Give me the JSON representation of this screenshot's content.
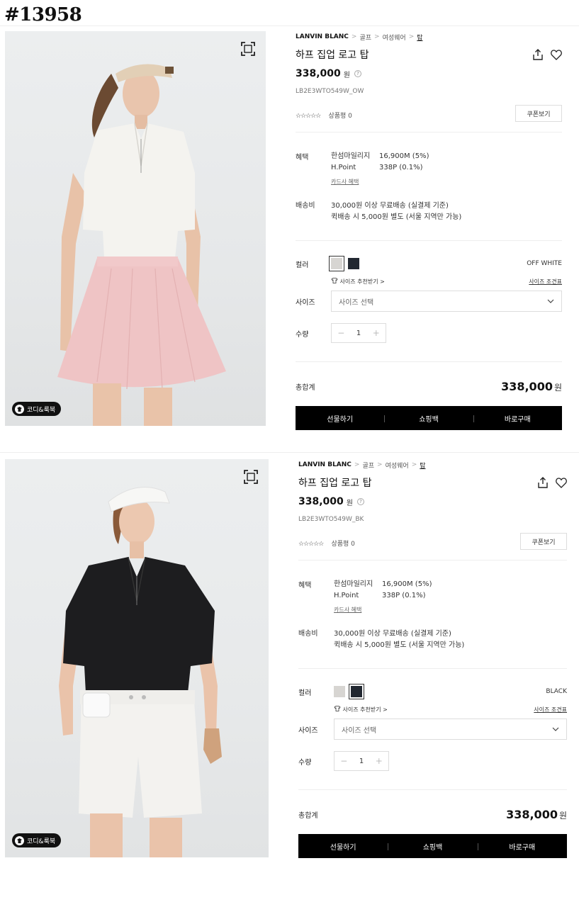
{
  "page_id": "#13958",
  "coord_label": "코디&룩북",
  "products": [
    {
      "breadcrumb": [
        "LANVIN BLANC",
        "골프",
        "여성웨어",
        "탑"
      ],
      "title": "하프 집업 로고 탑",
      "price": "338,000",
      "currency": "원",
      "code": "LB2E3WTO549W_OW",
      "stars": "☆☆☆☆☆",
      "review": "상품평 0",
      "coupon": "쿠폰보기",
      "benefit_label": "혜택",
      "benefit_items": [
        [
          "한섬마일리지",
          "16,900M (5%)"
        ],
        [
          "H.Point",
          "338P (0.1%)"
        ]
      ],
      "card_link": "카드사 혜택",
      "ship_label": "배송비",
      "ship_lines": [
        "30,000원 이상 무료배송 (실결제 기준)",
        "퀵배송 시 5,000원 별도 (서울 지역만 가능)"
      ],
      "color_label": "컬러",
      "color_name": "OFF WHITE",
      "selected_swatch": "white",
      "size_reco": "사이즈 추천받기 >",
      "size_guide": "사이즈 조견표",
      "size_label": "사이즈",
      "size_placeholder": "사이즈 선택",
      "qty_label": "수량",
      "qty": "1",
      "total_label": "총합계",
      "total": "338,000",
      "buttons": [
        "선물하기",
        "쇼핑백",
        "바로구매"
      ]
    },
    {
      "breadcrumb": [
        "LANVIN BLANC",
        "골프",
        "여성웨어",
        "탑"
      ],
      "title": "하프 집업 로고 탑",
      "price": "338,000",
      "currency": "원",
      "code": "LB2E3WTO549W_BK",
      "stars": "☆☆☆☆☆",
      "review": "상품평 0",
      "coupon": "쿠폰보기",
      "benefit_label": "혜택",
      "benefit_items": [
        [
          "한섬마일리지",
          "16,900M (5%)"
        ],
        [
          "H.Point",
          "338P (0.1%)"
        ]
      ],
      "card_link": "카드사 혜택",
      "ship_label": "배송비",
      "ship_lines": [
        "30,000원 이상 무료배송 (실결제 기준)",
        "퀵배송 시 5,000원 별도 (서울 지역만 가능)"
      ],
      "color_label": "컬러",
      "color_name": "BLACK",
      "selected_swatch": "black",
      "size_reco": "사이즈 추천받기 >",
      "size_guide": "사이즈 조견표",
      "size_label": "사이즈",
      "size_placeholder": "사이즈 선택",
      "qty_label": "수량",
      "qty": "1",
      "total_label": "총합계",
      "total": "338,000",
      "buttons": [
        "선물하기",
        "쇼핑백",
        "바로구매"
      ]
    }
  ],
  "colors": {
    "swatch_white": "#d7d5d2",
    "swatch_black": "#222831",
    "button_bar": "#000000"
  }
}
